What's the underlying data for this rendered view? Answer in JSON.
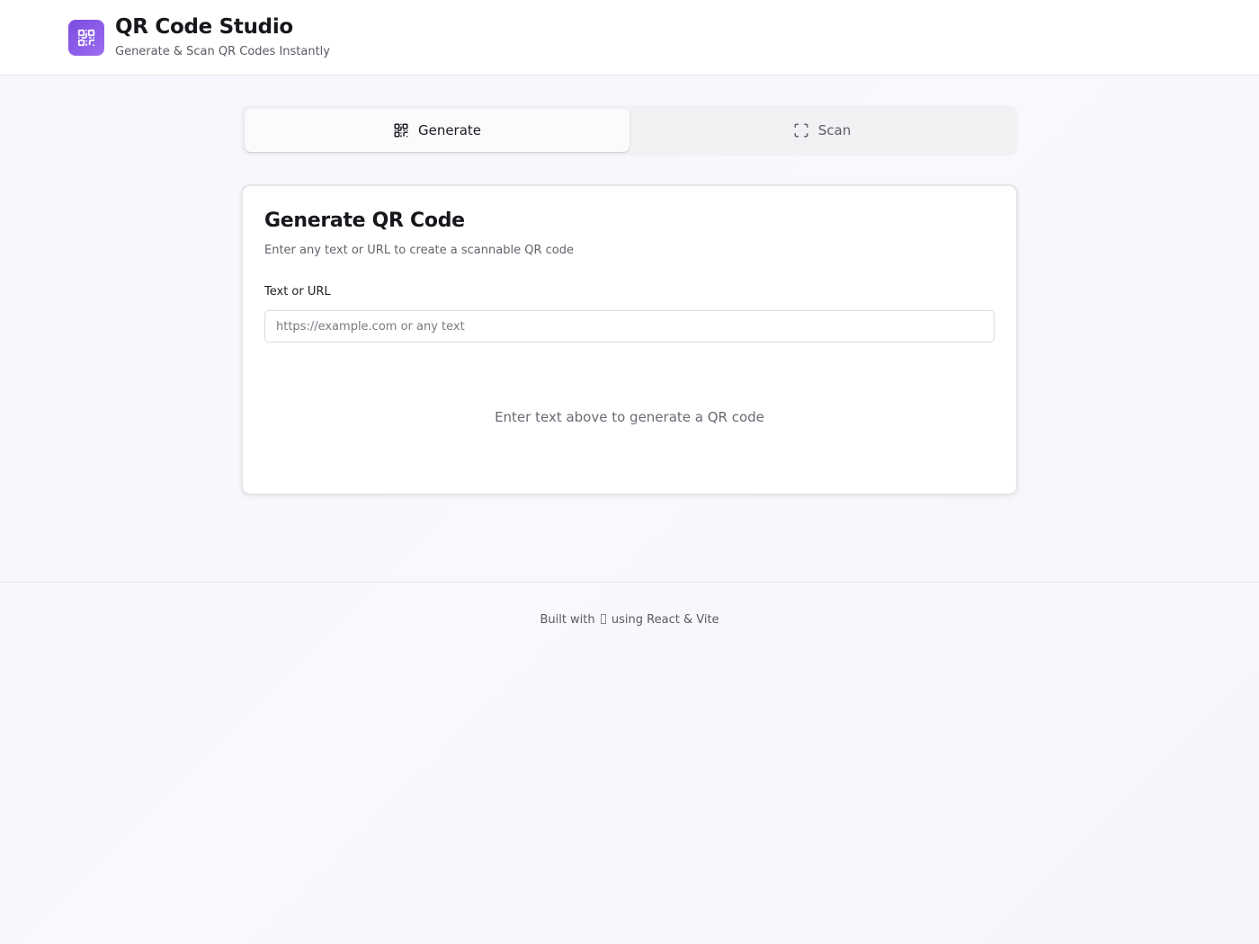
{
  "header": {
    "logo_icon": "qr-code-icon",
    "title": "QR Code Studio",
    "subtitle": "Generate & Scan QR Codes Instantly",
    "accent_color": "#8a5cf0"
  },
  "tabs": [
    {
      "label": "Generate",
      "icon": "qr-code-icon",
      "active": true
    },
    {
      "label": "Scan",
      "icon": "scan-frame-icon",
      "active": false
    }
  ],
  "generate": {
    "title": "Generate QR Code",
    "description": "Enter any text or URL to create a scannable QR code",
    "field_label": "Text or URL",
    "input_value": "",
    "input_placeholder": "https://example.com or any text",
    "empty_message": "Enter text above to generate a QR code"
  },
  "footer": {
    "text_before": "Built with",
    "heart_icon": "heart-icon",
    "text_after": "using React & Vite"
  }
}
